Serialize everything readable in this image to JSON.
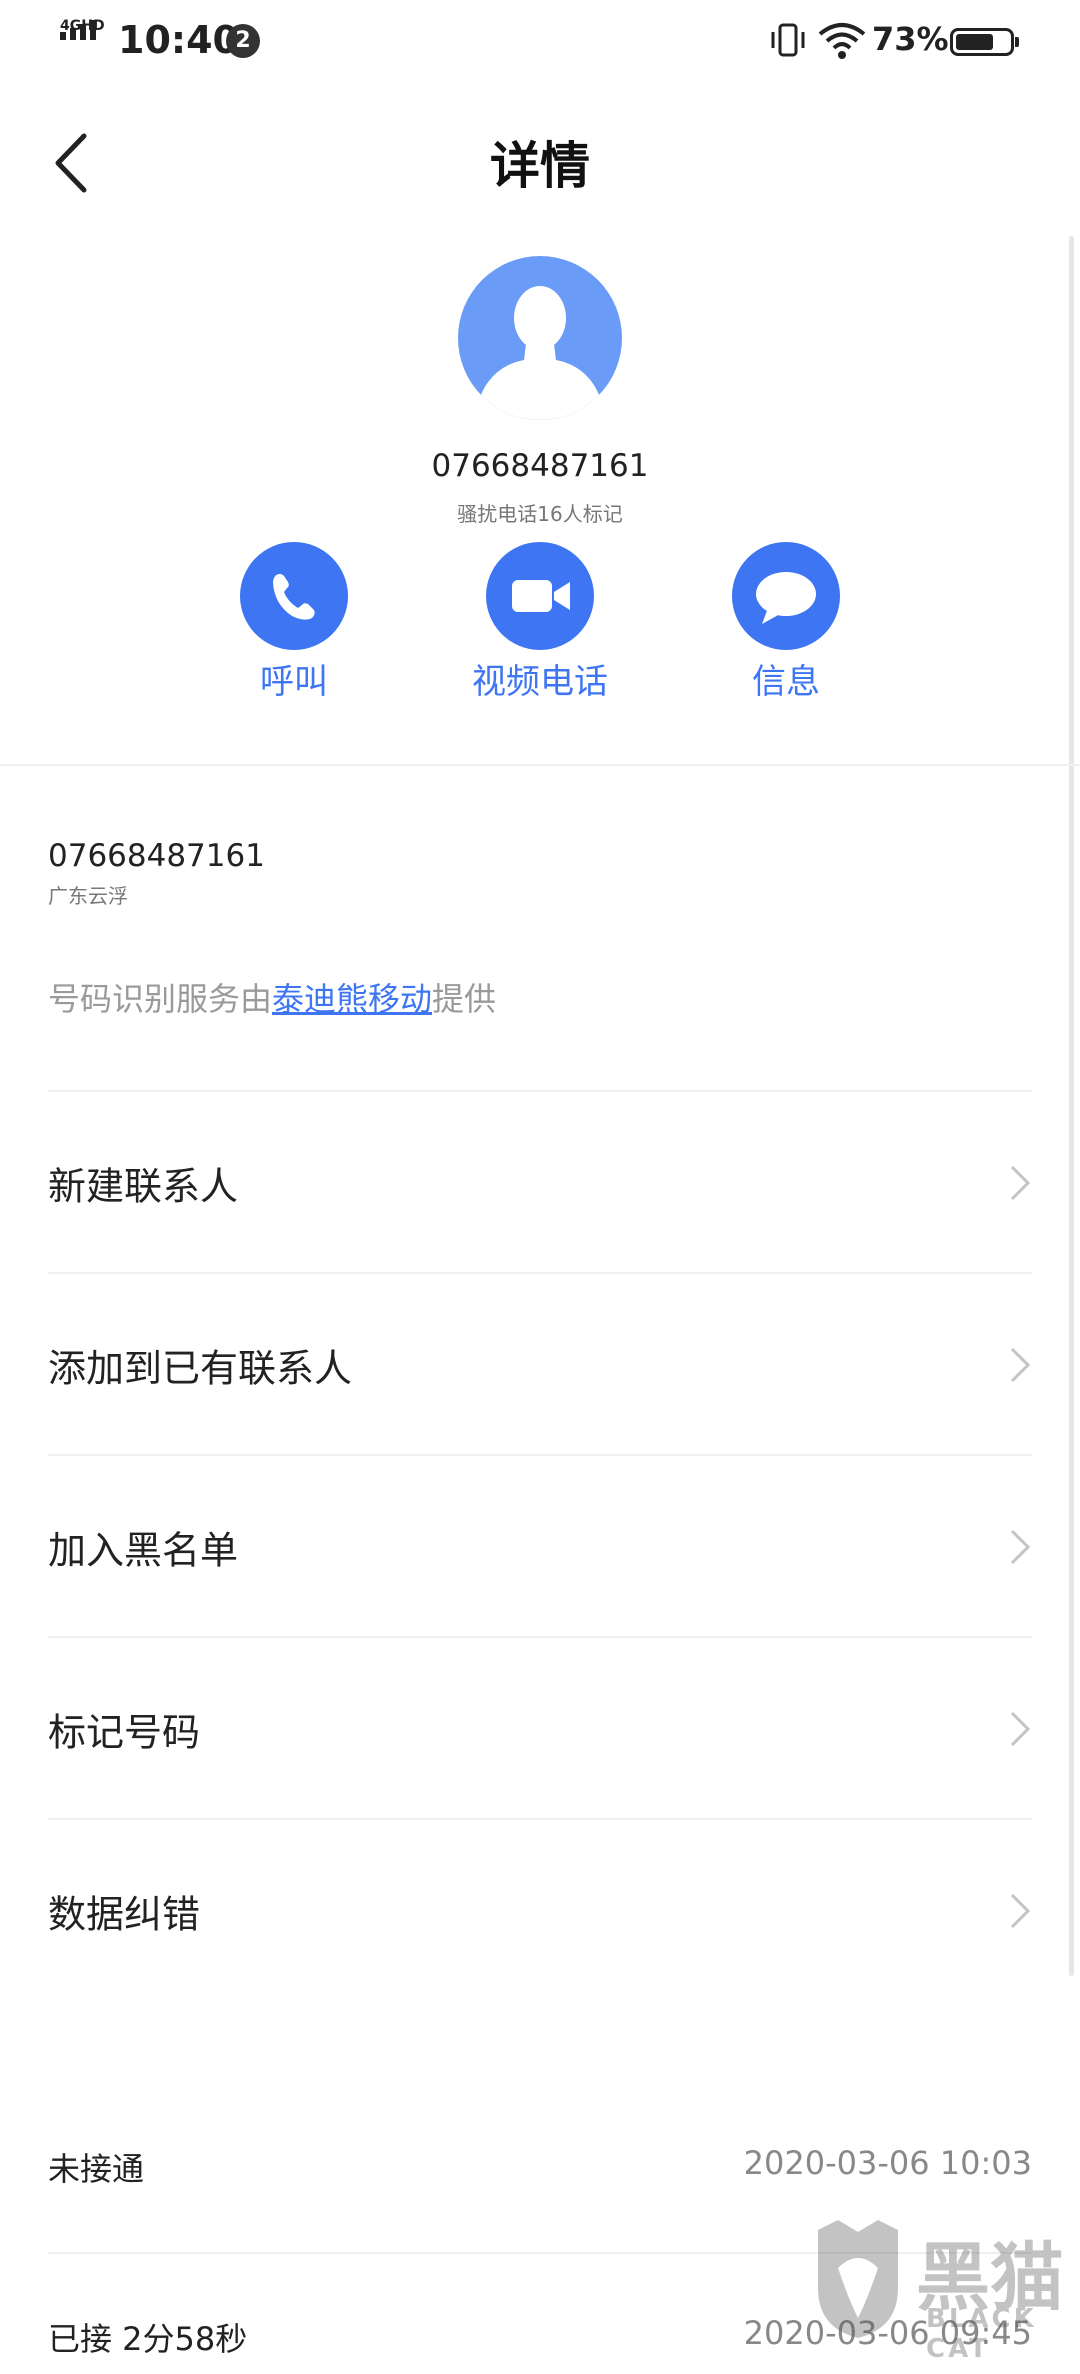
{
  "status_bar": {
    "network": "4GHD",
    "time": "10:40",
    "notification_count": "2",
    "battery": "73%"
  },
  "header": {
    "title": "详情"
  },
  "contact": {
    "number": "07668487161",
    "spam_note": "骚扰电话16人标记"
  },
  "actions": [
    {
      "label": "呼叫",
      "icon": "phone-icon"
    },
    {
      "label": "视频电话",
      "icon": "video-icon"
    },
    {
      "label": "信息",
      "icon": "message-icon"
    }
  ],
  "number_info": {
    "number": "07668487161",
    "location": "广东云浮",
    "provider_prefix": "号码识别服务由",
    "provider_link": "泰迪熊移动",
    "provider_suffix": "提供"
  },
  "menu": [
    {
      "label": "新建联系人"
    },
    {
      "label": "添加到已有联系人"
    },
    {
      "label": "加入黑名单"
    },
    {
      "label": "标记号码"
    },
    {
      "label": "数据纠错"
    }
  ],
  "call_log": [
    {
      "status": "未接通",
      "time": "2020-03-06 10:03"
    },
    {
      "status": "已接 2分58秒",
      "time": "2020-03-06 09:45"
    }
  ],
  "watermark": {
    "text": "黑猫",
    "sub": "BLACK CAT"
  },
  "colors": {
    "accent": "#3e75f2",
    "avatar_bg": "#6a9bf7"
  }
}
